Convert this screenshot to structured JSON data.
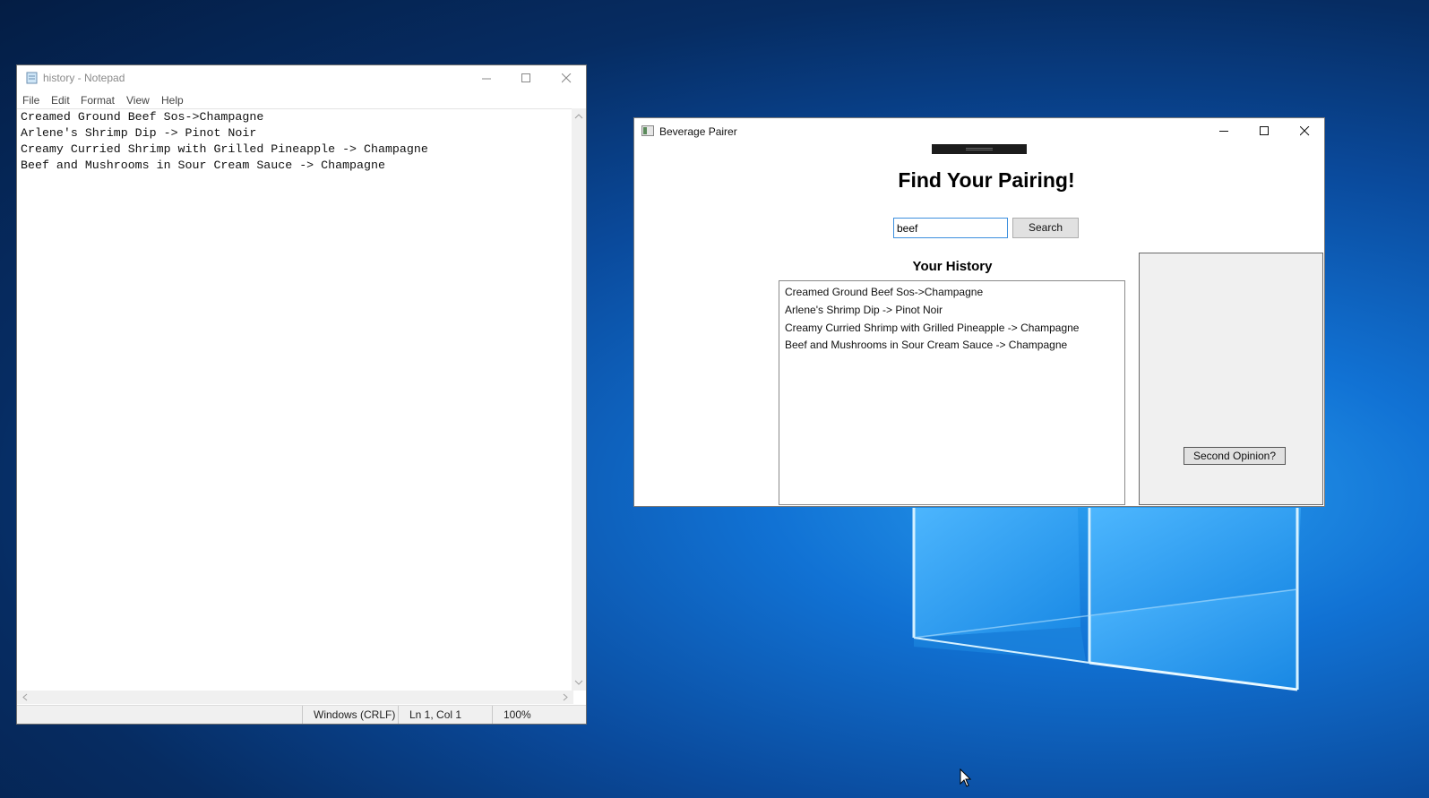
{
  "notepad": {
    "title": "history - Notepad",
    "menu": [
      "File",
      "Edit",
      "Format",
      "View",
      "Help"
    ],
    "lines": [
      "Creamed Ground Beef Sos->Champagne",
      "Arlene's Shrimp Dip -> Pinot Noir",
      "Creamy Curried Shrimp with Grilled Pineapple -> Champagne",
      "Beef and Mushrooms in Sour Cream Sauce -> Champagne"
    ],
    "status": {
      "line_ending": "Windows (CRLF)",
      "position": "Ln 1, Col 1",
      "zoom": "100%"
    }
  },
  "app": {
    "title": "Beverage Pairer",
    "heading": "Find Your Pairing!",
    "search": {
      "value": "beef",
      "button_label": "Search"
    },
    "history": {
      "label": "Your History",
      "items": [
        "Creamed Ground Beef Sos->Champagne",
        "Arlene's Shrimp Dip -> Pinot Noir",
        "Creamy Curried Shrimp with Grilled Pineapple -> Champagne",
        "Beef and Mushrooms in Sour Cream Sauce -> Champagne"
      ]
    },
    "second_opinion_label": "Second Opinion?"
  },
  "icons": {
    "minimize": "minimize-icon",
    "maximize": "maximize-icon",
    "close": "close-icon",
    "notepad": "notepad-icon",
    "app": "app-window-icon",
    "cursor": "mouse-cursor-icon"
  },
  "colors": {
    "desktop_blue": "#0a4a9c",
    "focus_border": "#3c8fde",
    "button_face": "#e1e1e1"
  }
}
